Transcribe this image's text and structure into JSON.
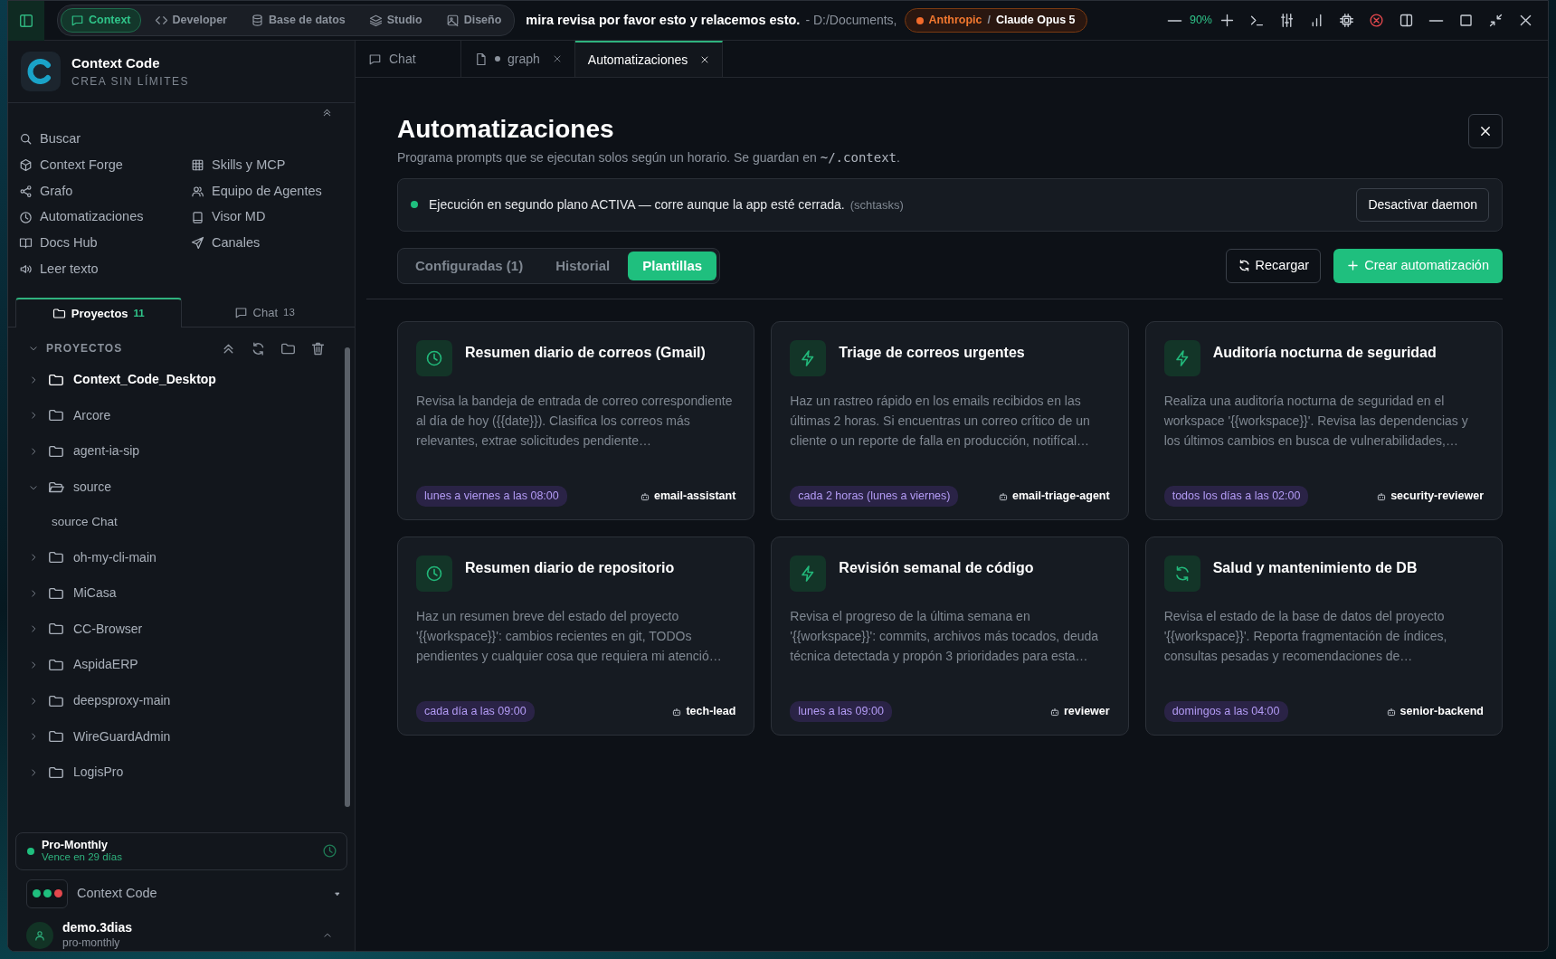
{
  "top_bar": {
    "modes": [
      {
        "label": "Context",
        "kind": "chat",
        "selected": true
      },
      {
        "label": "Developer",
        "kind": "code",
        "selected": false
      },
      {
        "label": "Base de datos",
        "kind": "database",
        "selected": false
      },
      {
        "label": "Studio",
        "kind": "layers",
        "selected": false
      },
      {
        "label": "Diseño",
        "kind": "image",
        "selected": false
      }
    ],
    "title": "mira revisa por favor esto y relacemos esto.",
    "path": "- D:/Documents,",
    "provider": "Anthropic",
    "separator": "/",
    "model": "Claude Opus 5",
    "zoom": "90%"
  },
  "sidebar": {
    "app_name": "Context Code",
    "tagline": "CREA SIN LÍMITES",
    "nav_left": [
      {
        "label": "Buscar",
        "kind": "search"
      },
      {
        "label": "Context Forge",
        "kind": "cube"
      },
      {
        "label": "Grafo",
        "kind": "share"
      },
      {
        "label": "Automatizaciones",
        "kind": "clock"
      },
      {
        "label": "Docs Hub",
        "kind": "book"
      },
      {
        "label": "Leer texto",
        "kind": "speaker"
      }
    ],
    "nav_right": [
      {
        "label": "Skills y MCP",
        "kind": "grid"
      },
      {
        "label": "Equipo de Agentes",
        "kind": "users"
      },
      {
        "label": "Visor MD",
        "kind": "tablet"
      },
      {
        "label": "Canales",
        "kind": "send"
      }
    ],
    "tabs": [
      {
        "label": "Proyectos",
        "count": "11",
        "kind": "folder",
        "selected": true
      },
      {
        "label": "Chat",
        "count": "13",
        "kind": "chat",
        "selected": false
      }
    ],
    "section_title": "PROYECTOS",
    "projects": [
      {
        "label": "Context_Code_Desktop",
        "selected": true,
        "expanded": false
      },
      {
        "label": "Arcore",
        "selected": false,
        "expanded": false
      },
      {
        "label": "agent-ia-sip",
        "selected": false,
        "expanded": false
      },
      {
        "label": "source",
        "selected": false,
        "expanded": true,
        "children": [
          {
            "label": "source Chat"
          }
        ]
      },
      {
        "label": "oh-my-cli-main",
        "selected": false,
        "expanded": false
      },
      {
        "label": "MiCasa",
        "selected": false,
        "expanded": false
      },
      {
        "label": "CC-Browser",
        "selected": false,
        "expanded": false
      },
      {
        "label": "AspidaERP",
        "selected": false,
        "expanded": false
      },
      {
        "label": "deepsproxy-main",
        "selected": false,
        "expanded": false
      },
      {
        "label": "WireGuardAdmin",
        "selected": false,
        "expanded": false
      },
      {
        "label": "LogisPro",
        "selected": false,
        "expanded": false
      }
    ],
    "plan": {
      "name": "Pro-Monthly",
      "expiry": "Vence en 29 días"
    },
    "workspace": "Context Code",
    "user": {
      "name": "demo.3dias",
      "plan": "pro-monthly"
    }
  },
  "editor_tabs": [
    {
      "label": "Chat",
      "kind": "chat",
      "modified": false,
      "closable": false,
      "selected": false
    },
    {
      "label": "graph",
      "kind": "file",
      "modified": true,
      "closable": true,
      "selected": false
    },
    {
      "label": "Automatizaciones",
      "kind": "none",
      "modified": false,
      "closable": true,
      "selected": true
    }
  ],
  "page": {
    "title": "Automatizaciones",
    "subtitle": "Programa prompts que se ejecutan solos según un horario. Se guardan en ",
    "subtitle_code": "~/.context",
    "subtitle_end": ".",
    "daemon": {
      "active": true,
      "message": "Ejecución en segundo plano ACTIVA — corre aunque la app esté cerrada.",
      "note": "(schtasks)",
      "button": "Desactivar daemon"
    },
    "tabs": [
      {
        "label": "Configuradas (1)",
        "selected": false
      },
      {
        "label": "Historial",
        "selected": false
      },
      {
        "label": "Plantillas",
        "selected": true
      }
    ],
    "reload_button": "Recargar",
    "create_button": "Crear automatización",
    "templates": [
      {
        "title": "Resumen diario de correos (Gmail)",
        "kind": "clock",
        "description": "Revisa la bandeja de entrada de correo correspondiente al día de hoy ({{date}}). Clasifica los correos más relevantes, extrae solicitudes pendiente…",
        "schedule": "lunes a viernes a las 08:00",
        "agent": "email-assistant"
      },
      {
        "title": "Triage de correos urgentes",
        "kind": "bolt",
        "description": "Haz un rastreo rápido en los emails recibidos en las últimas 2 horas. Si encuentras un correo crítico de un cliente o un reporte de falla en producción, notifícal…",
        "schedule": "cada 2 horas (lunes a viernes)",
        "agent": "email-triage-agent"
      },
      {
        "title": "Auditoría nocturna de seguridad",
        "kind": "bolt",
        "description": "Realiza una auditoría nocturna de seguridad en el workspace '{{workspace}}'. Revisa las dependencias y los últimos cambios en busca de vulnerabilidades,…",
        "schedule": "todos los días a las 02:00",
        "agent": "security-reviewer"
      },
      {
        "title": "Resumen diario de repositorio",
        "kind": "clock",
        "description": "Haz un resumen breve del estado del proyecto '{{workspace}}': cambios recientes en git, TODOs pendientes y cualquier cosa que requiera mi atenció…",
        "schedule": "cada día a las 09:00",
        "agent": "tech-lead"
      },
      {
        "title": "Revisión semanal de código",
        "kind": "bolt",
        "description": "Revisa el progreso de la última semana en '{{workspace}}': commits, archivos más tocados, deuda técnica detectada y propón 3 prioridades para esta…",
        "schedule": "lunes a las 09:00",
        "agent": "reviewer"
      },
      {
        "title": "Salud y mantenimiento de DB",
        "kind": "refresh",
        "description": "Revisa el estado de la base de datos del proyecto '{{workspace}}'. Reporta fragmentación de índices, consultas pesadas y recomendaciones de…",
        "schedule": "domingos a las 04:00",
        "agent": "senior-backend"
      }
    ]
  }
}
